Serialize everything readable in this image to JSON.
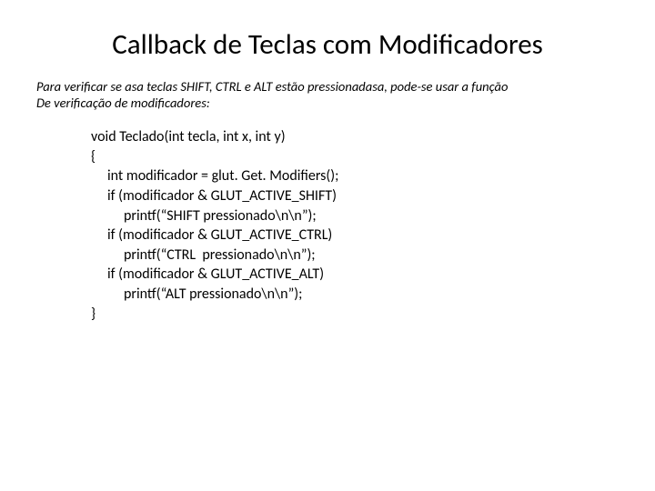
{
  "title": "Callback de Teclas com Modificadores",
  "subtitle_line1": "Para verificar se asa teclas SHIFT, CTRL e ALT estão pressionadasa, pode-se usar a função",
  "subtitle_line2": "De verificação de modificadores:",
  "code": {
    "l0": "void Teclado(int tecla, int x, int y)",
    "l1": "{",
    "l2": "int modificador = glut. Get. Modifiers();",
    "l3": "if (modificador & GLUT_ACTIVE_SHIFT)",
    "l4": "printf(“SHIFT pressionado\\n\\n”);",
    "l5": "if (modificador & GLUT_ACTIVE_CTRL)",
    "l6": "printf(“CTRL  pressionado\\n\\n”);",
    "l7": "if (modificador & GLUT_ACTIVE_ALT)",
    "l8": "printf(“ALT pressionado\\n\\n”);",
    "l9": "}"
  }
}
